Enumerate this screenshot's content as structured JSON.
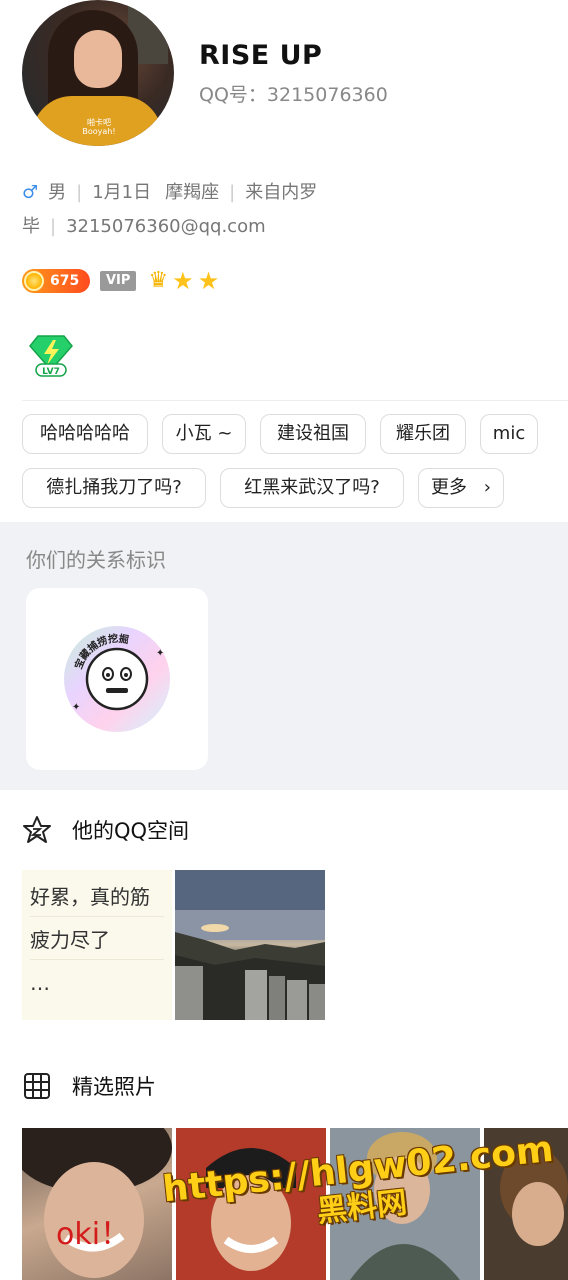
{
  "profile": {
    "nickname": "RISE UP",
    "qq_label": "QQ号：3215076360",
    "avatar_caption_1": "啪卡吧",
    "avatar_caption_2": "Booyah!"
  },
  "info": {
    "gender": "男",
    "birthday": "1月1日",
    "zodiac": "摩羯座",
    "location": "来自内罗毕",
    "email": "3215076360@qq.com"
  },
  "badges": {
    "coin_count": "675",
    "vip": "VIP",
    "gem_level": "LV7"
  },
  "tags": [
    "哈哈哈哈哈",
    "小瓦 ~",
    "建设祖国",
    "耀乐团",
    "mic",
    "德扎捅我刀了吗?",
    "红黑来武汉了吗?",
    "更多"
  ],
  "relation": {
    "title": "你们的关系标识",
    "badge_text": "宝藏捕捞挖掘"
  },
  "qzone": {
    "title": "他的QQ空间",
    "post_line1": "好累，真的筋",
    "post_line2": "疲力尽了",
    "post_line3": "…"
  },
  "photos": {
    "title": "精选照片",
    "overlay_text": "oki！"
  },
  "watermark": {
    "url": "https://hlgw02.com",
    "site": "黑料网"
  },
  "colors": {
    "accent_male": "#3d8ee8",
    "section_bg": "#f1f2f6",
    "watermark": "#ffcf17"
  }
}
